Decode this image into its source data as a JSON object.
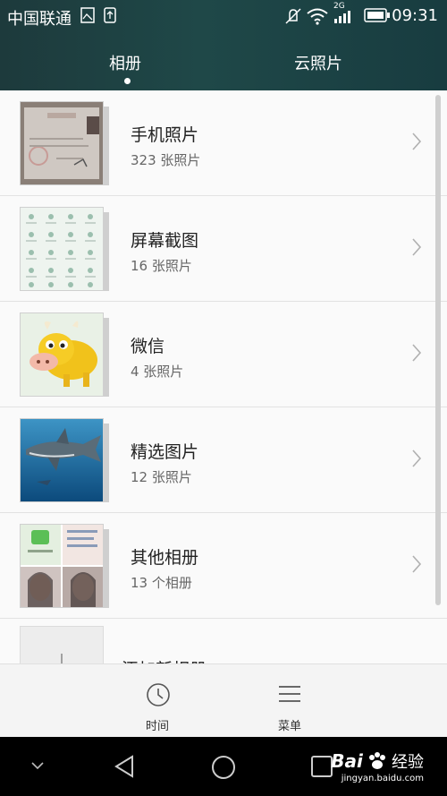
{
  "status_bar": {
    "carrier": "中国联通",
    "network_type": "2G",
    "time": "09:31"
  },
  "tabs": [
    {
      "label": "相册",
      "selected": true
    },
    {
      "label": "云照片",
      "selected": false
    }
  ],
  "albums": [
    {
      "name": "手机照片",
      "count": "323 张照片",
      "thumb_icon": "certificate-photo-thumbnail"
    },
    {
      "name": "屏幕截图",
      "count": "16 张照片",
      "thumb_icon": "screenshot-grid-thumbnail"
    },
    {
      "name": "微信",
      "count": "4 张照片",
      "thumb_icon": "cartoon-cow-thumbnail"
    },
    {
      "name": "精选图片",
      "count": "12 张照片",
      "thumb_icon": "shark-thumbnail"
    },
    {
      "name": "其他相册",
      "count": "13 个相册",
      "thumb_icon": "collage-thumbnail"
    },
    {
      "name": "添加新相册",
      "count": "",
      "thumb_icon": "plus-icon"
    }
  ],
  "bottom_bar": {
    "time_label": "时间",
    "menu_label": "菜单"
  },
  "watermark": {
    "brand": "Bai",
    "brand_suffix": "经验",
    "url": "jingyan.baidu.com"
  },
  "colors": {
    "header_bg": "#1f4848",
    "list_bg": "#fafafa",
    "navbar_bg": "#000000"
  }
}
